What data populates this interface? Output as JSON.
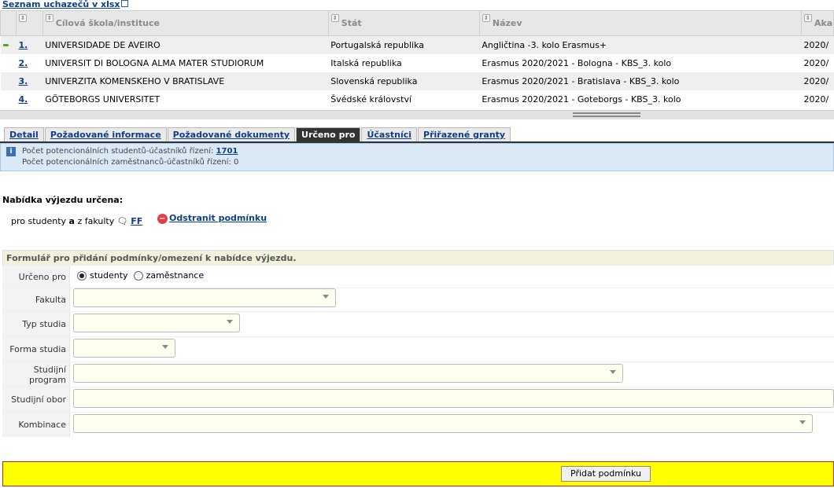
{
  "export_link": "Seznam uchazečů v xlsx",
  "columns": [
    "Cílová škola/instituce",
    "Stát",
    "Název",
    "Aka"
  ],
  "rows": [
    {
      "num": "1.",
      "school": "UNIVERSIDADE DE AVEIRO",
      "state": "Portugalská republika",
      "name": "Angličtina -3. kolo Erasmus+",
      "year": "2020/"
    },
    {
      "num": "2.",
      "school": "UNIVERSIT DI BOLOGNA ALMA MATER STUDIORUM",
      "state": "Italská republika",
      "name": "Erasmus 2020/2021 - Bologna - KBS_3. kolo",
      "year": "2020/"
    },
    {
      "num": "3.",
      "school": "UNIVERZITA KOMENSKEHO V BRATISLAVE",
      "state": "Slovenská republika",
      "name": "Erasmus 2020/2021 - Bratislava - KBS_3. kolo",
      "year": "2020/"
    },
    {
      "num": "4.",
      "school": "GÖTEBORGS UNIVERSITET",
      "state": "Švédské království",
      "name": "Erasmus 2020/2021 - Goteborgs - KBS_3. kolo",
      "year": "2020/"
    }
  ],
  "tabs": [
    "Detail",
    "Požadované informace",
    "Požadované dokumenty",
    "Určeno pro",
    "Účastníci",
    "Přiřazené granty"
  ],
  "info": {
    "students_label": "Počet potencionálních studentů-účastníků řízení:",
    "students_count": "1701",
    "employees_label": "Počet potencionálních zaměstnanců-účastníků řízení: 0"
  },
  "offer_title": "Nabídka výjezdu určena:",
  "condition": {
    "prefix": "pro studenty ",
    "mid": "a",
    "suffix": " z fakulty ",
    "faculty": "FF"
  },
  "remove_label": "Odstranit podmínku",
  "form": {
    "title": "Formulář pro přidání podmínky/omezení k nabídce výjezdu.",
    "labels": {
      "urceno": "Určeno pro",
      "fakulta": "Fakulta",
      "typ": "Typ studia",
      "forma": "Forma studia",
      "program": "Studijní program",
      "obor": "Studijní obor",
      "kombinace": "Kombinace"
    },
    "radio_students": "studenty",
    "radio_employees": "zaměstnance"
  },
  "submit_label": "Přidat podmínku",
  "colors": {
    "tab_active": "#333333",
    "info_bg": "#dbe9f7",
    "submit_bar": "#ffff00",
    "link": "#0b3f8a"
  }
}
